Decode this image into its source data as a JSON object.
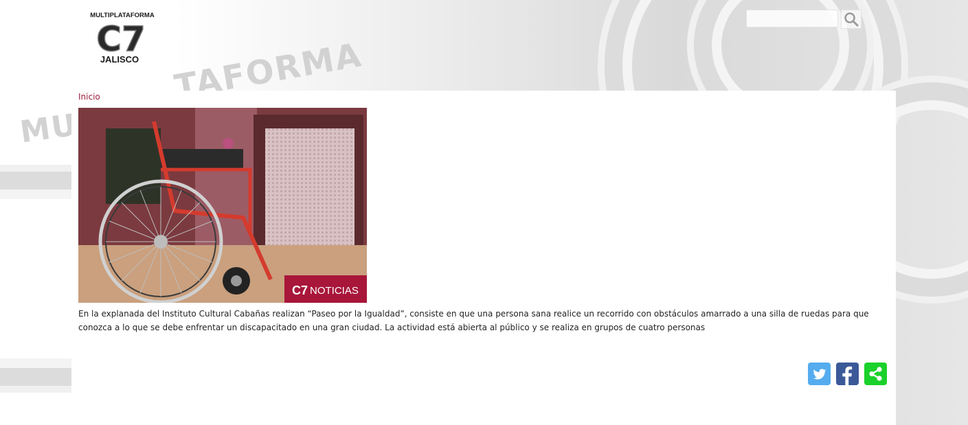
{
  "header": {
    "logo": {
      "top_text": "MULTIPLATAFORMA",
      "mark_text": "C7",
      "bottom_text": "JALISCO"
    },
    "search": {
      "placeholder": "",
      "value": ""
    }
  },
  "breadcrumb": {
    "home_label": "Inicio"
  },
  "article": {
    "image_overlay_label": "NOTICIAS",
    "image_overlay_mark": "C7",
    "body": "En la explanada del Instituto Cultural Cabañas realizan “Paseo por la Igualdad”, consiste en que una persona sana realice un recorrido con obstáculos amarrado a una silla de ruedas para que conozca a lo que se debe enfrentar un discapacitado en una gran ciudad. La actividad está abierta al público y se realiza en grupos de cuatro personas"
  },
  "share": {
    "buttons": [
      {
        "icon": "twitter-icon",
        "color": "#55acee"
      },
      {
        "icon": "facebook-icon",
        "color": "#3b5998"
      },
      {
        "icon": "share-icon",
        "color": "#1bd12b"
      }
    ]
  },
  "colors": {
    "link": "#9b1b3b",
    "text": "#222222",
    "panel": "#ffffff"
  }
}
